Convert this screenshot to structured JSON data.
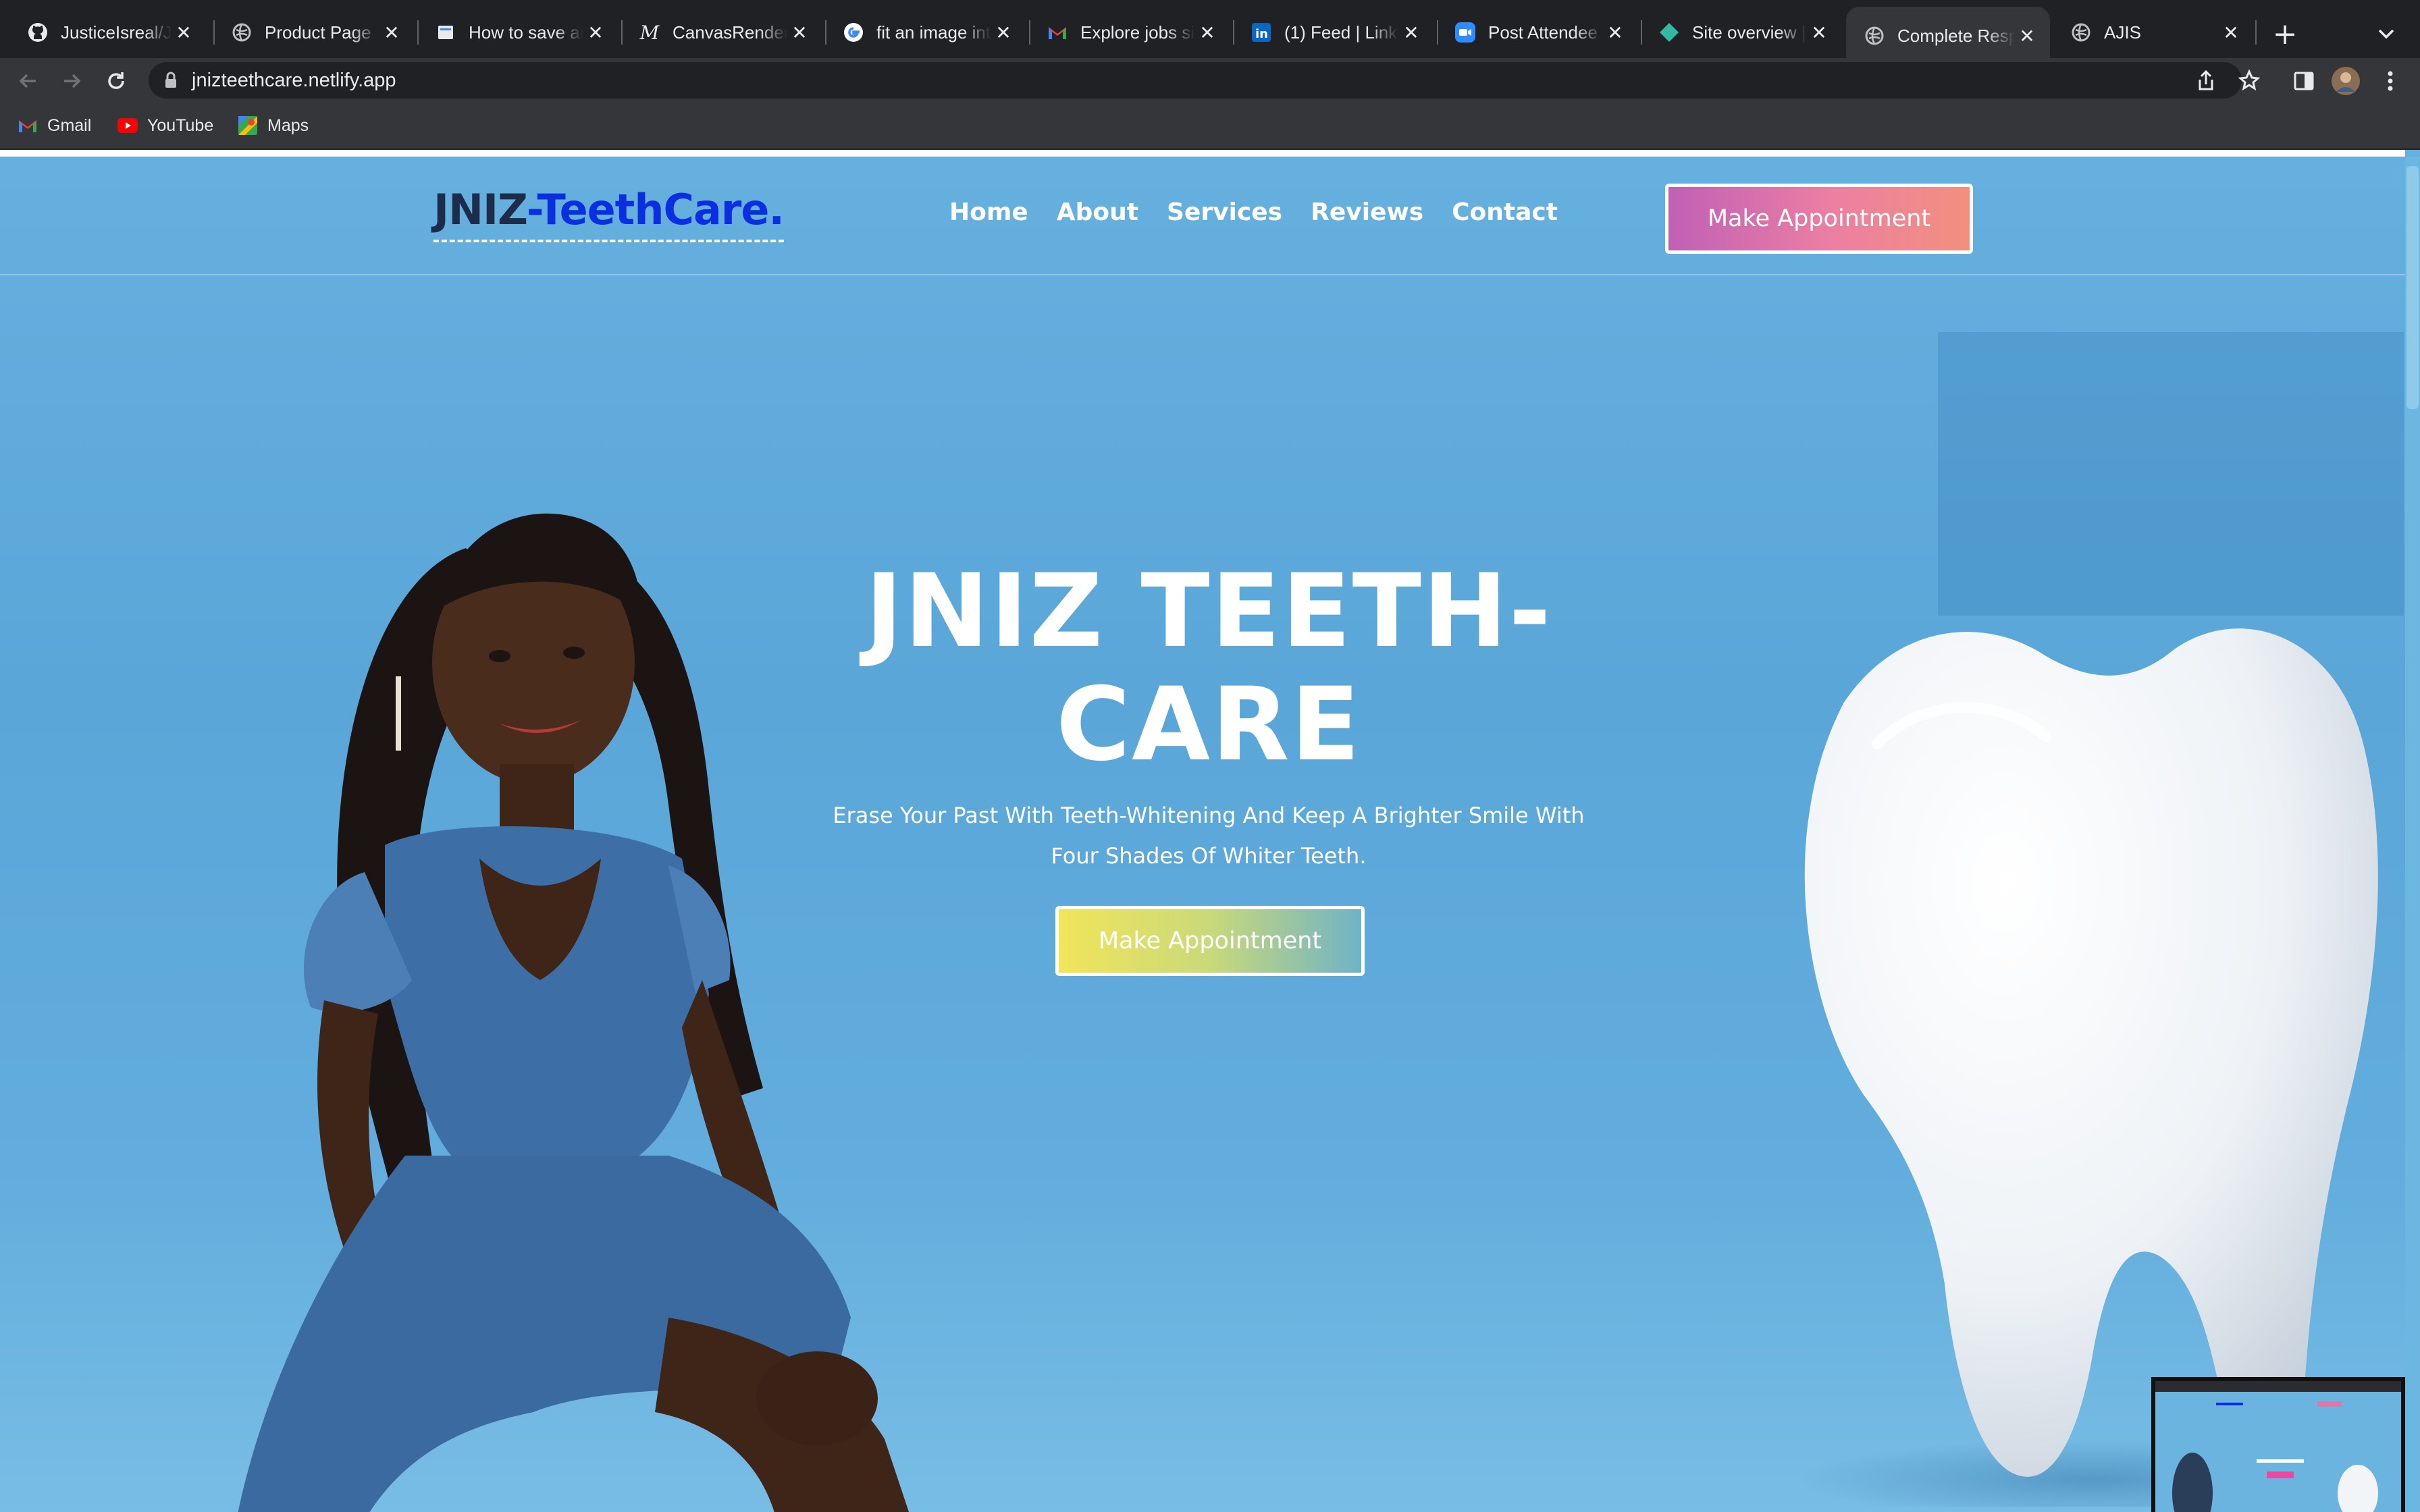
{
  "browser": {
    "tabs": [
      {
        "title": "JusticeIsreal/Je",
        "icon": "github-icon"
      },
      {
        "title": "Product Page",
        "icon": "globe-icon"
      },
      {
        "title": "How to save an",
        "icon": "page-icon"
      },
      {
        "title": "CanvasRenderi",
        "icon": "medium-icon"
      },
      {
        "title": "fit an image into",
        "icon": "google-icon"
      },
      {
        "title": "Explore jobs sin",
        "icon": "gmail-icon"
      },
      {
        "title": "(1) Feed | Linke",
        "icon": "linkedin-icon"
      },
      {
        "title": "Post Attendee",
        "icon": "zoom-icon"
      },
      {
        "title": "Site overview |",
        "icon": "netlify-icon"
      },
      {
        "title": "Complete Resp",
        "icon": "globe-icon"
      },
      {
        "title": "AJIS",
        "icon": "globe-icon"
      }
    ],
    "active_tab_index": 9,
    "url": "jnizteethcare.netlify.app",
    "bookmarks": [
      {
        "label": "Gmail",
        "icon": "gmail-icon"
      },
      {
        "label": "YouTube",
        "icon": "youtube-icon"
      },
      {
        "label": "Maps",
        "icon": "maps-icon"
      }
    ]
  },
  "site": {
    "logo": {
      "part1": "JNIZ",
      "part2": "-TeethCare."
    },
    "nav": [
      "Home",
      "About",
      "Services",
      "Reviews",
      "Contact"
    ],
    "header_cta": "Make Appointment",
    "hero": {
      "title": "JNIZ TEETH-CARE",
      "subtitle": "Erase Your Past With Teeth-Whitening And Keep A Brighter Smile With Four Shades Of Whiter Teeth.",
      "cta": "Make Appointment"
    }
  },
  "colors": {
    "page_bg": "#5aa6d8",
    "logo_dark": "#1c2c4a",
    "logo_blue": "#0a2fe0",
    "header_cta_gradient": [
      "#c060b6",
      "#f2907e"
    ],
    "hero_cta_gradient": [
      "#f1e55a",
      "#6fb3c6"
    ]
  }
}
